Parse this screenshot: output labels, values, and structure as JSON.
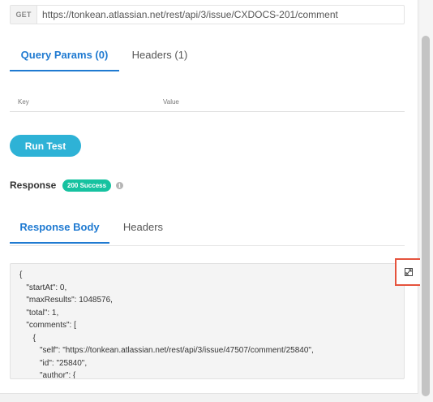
{
  "request": {
    "method": "GET",
    "url": "https://tonkean.atlassian.net/rest/api/3/issue/CXDOCS-201/comment"
  },
  "request_tabs": [
    {
      "label": "Query Params (0)",
      "active": true
    },
    {
      "label": "Headers (1)",
      "active": false
    }
  ],
  "params_table": {
    "key_header": "Key",
    "value_header": "Value"
  },
  "run_button": {
    "label": "Run Test"
  },
  "response": {
    "label": "Response",
    "status": "200 Success",
    "status_color": "#16c2a0",
    "info_icon": "info-icon"
  },
  "response_tabs": [
    {
      "label": "Response Body",
      "active": true
    },
    {
      "label": "Headers",
      "active": false
    }
  ],
  "response_body": {
    "lines": [
      "{",
      "   \"startAt\": 0,",
      "   \"maxResults\": 1048576,",
      "   \"total\": 1,",
      "   \"comments\": [",
      "      {",
      "         \"self\": \"https://tonkean.atlassian.net/rest/api/3/issue/47507/comment/25840\",",
      "         \"id\": \"25840\",",
      "         \"author\": {"
    ]
  },
  "expand_button": {
    "icon": "expand-icon",
    "highlight_color": "#e5533d"
  },
  "colors": {
    "accent": "#1f7ad1",
    "run_button": "#2eb2d6"
  }
}
